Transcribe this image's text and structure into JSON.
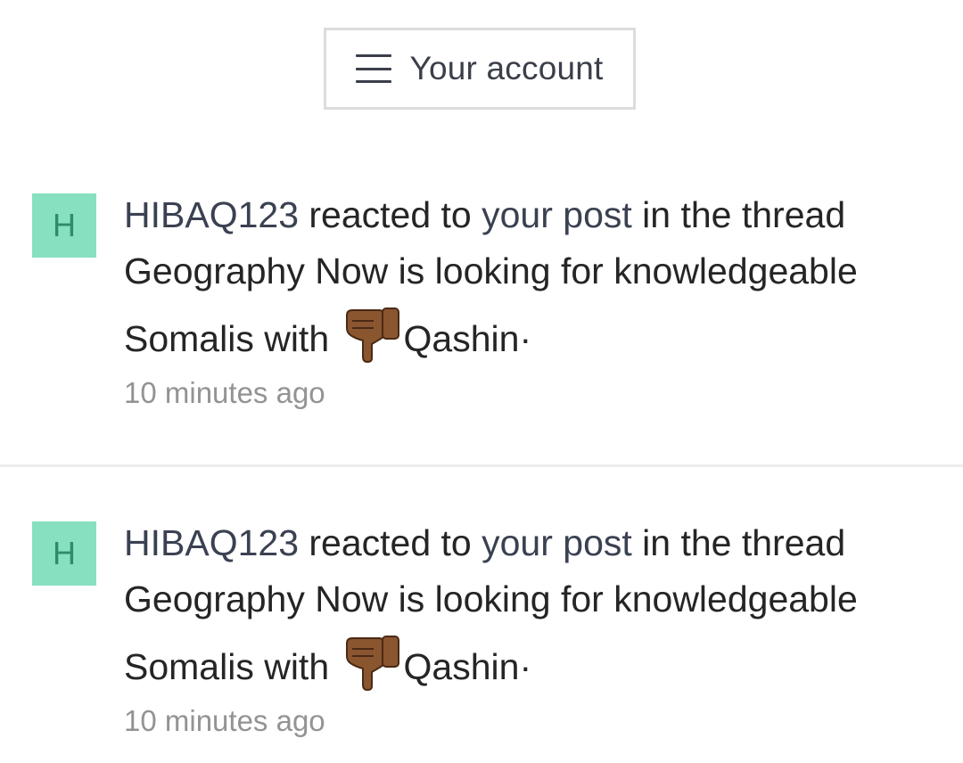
{
  "header": {
    "account_label": "Your account",
    "menu_icon": "hamburger-menu-icon"
  },
  "colors": {
    "avatar_bg": "#87e0c0",
    "avatar_fg": "#2f8c6b",
    "link": "#3a4151",
    "time": "#939393",
    "divider": "#ececec"
  },
  "alerts": [
    {
      "avatar_letter": "H",
      "user": "HIBAQ123",
      "text_reacted": " reacted to ",
      "post_link": "your post",
      "text_thread": " in the thread Geography Now is looking for knowledgeable Somalis with ",
      "reaction_icon": "thumbs-down-icon",
      "reaction_label": "Qashin",
      "end_mark": "·",
      "time": "10 minutes ago"
    },
    {
      "avatar_letter": "H",
      "user": "HIBAQ123",
      "text_reacted": " reacted to ",
      "post_link": "your post",
      "text_thread": " in the thread Geography Now is looking for knowledgeable Somalis with ",
      "reaction_icon": "thumbs-down-icon",
      "reaction_label": "Qashin",
      "end_mark": "·",
      "time": "10 minutes ago"
    }
  ]
}
